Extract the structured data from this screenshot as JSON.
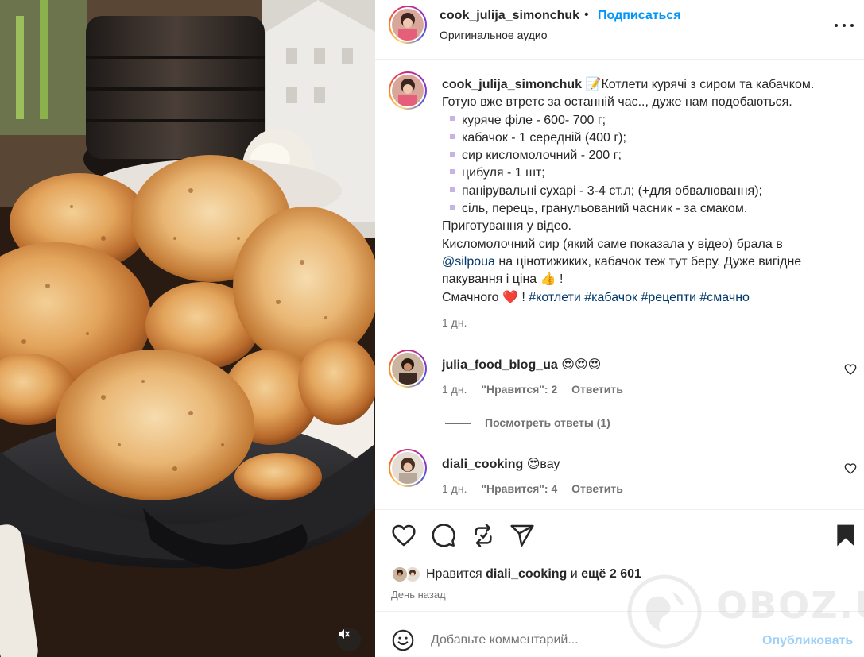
{
  "header": {
    "username": "cook_julija_simonchuk",
    "dot": "•",
    "follow_label": "Подписаться",
    "audio": "Оригинальное аудио",
    "more_icon": "more-horizontal-icon"
  },
  "caption": {
    "username": "cook_julija_simonchuk",
    "emoji": "📝",
    "title": "Котлети курячі з сиром та кабачком.",
    "intro": "Готую вже втретє за останній час.., дуже нам подобаються.",
    "ingredients": [
      "куряче філе - 600- 700 г;",
      "кабачок - 1 середній (400 г);",
      "сир кисломолочний - 200 г;",
      "цибуля - 1 шт;",
      "панірувальні сухарі - 3-4 ст.л; (+для обвалювання);",
      "сіль, перець, гранульований часник - за смаком."
    ],
    "prep": "Приготування у відео.",
    "note_start": "Кисломолочний сир (який саме показала у відео) брала в",
    "mention": "@silpoua",
    "note_end": " на цінотижиких, кабачок теж тут беру. Дуже вигідне пакування і ціна 👍 !",
    "closing": "Смачного ❤️ ! ",
    "hashtags": "#котлети #кабачок #рецепти #смачно",
    "time": "1 дн."
  },
  "comments": [
    {
      "username": "julia_food_blog_ua",
      "text": "😍😍😍",
      "time": "1 дн.",
      "likes": "\"Нравится\": 2",
      "reply": "Ответить",
      "heart_icon": "heart-outline-icon"
    },
    {
      "username": "diali_cooking",
      "text": "😍вау",
      "time": "1 дн.",
      "likes": "\"Нравится\": 4",
      "reply": "Ответить",
      "heart_icon": "heart-outline-icon"
    }
  ],
  "view_replies": "Посмотреть ответы (1)",
  "actions": {
    "like_icon": "heart-icon",
    "comment_icon": "comment-icon",
    "repost_icon": "repost-icon",
    "share_icon": "share-icon",
    "save_icon": "bookmark-icon"
  },
  "likes": {
    "prefix": "Нравится ",
    "user": "diali_cooking",
    "middle": " и ",
    "count": "ещё 2 601"
  },
  "when": "День назад",
  "comment_box": {
    "placeholder": "Добавьте комментарий...",
    "publish": "Опубликовать",
    "emoji_icon": "smiley-icon"
  },
  "media": {
    "mute_icon": "speaker-muted-icon"
  },
  "watermark": "OBOZ.UA",
  "colors": {
    "link_blue": "#0095f6",
    "mention_blue": "#00376b",
    "muted_gray": "#737373",
    "publish_disabled": "#9fd1f7"
  }
}
